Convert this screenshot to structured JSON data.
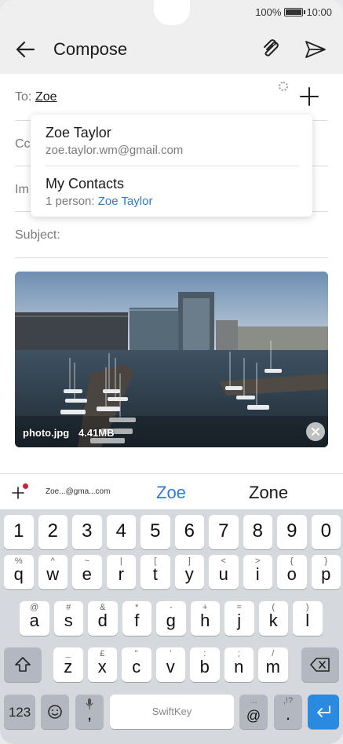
{
  "status_bar": {
    "battery_percent": "100%",
    "battery_level": 1.0,
    "time": "10:00"
  },
  "app_bar": {
    "title": "Compose",
    "back_icon": "arrow-left-icon",
    "attach_icon": "paperclip-icon",
    "send_icon": "send-icon"
  },
  "form": {
    "to_label": "To:",
    "to_value": "Zoe",
    "cc_label": "Cc",
    "im_label": "Im",
    "subject_label": "Subject:"
  },
  "suggestions": [
    {
      "name": "Zoe Taylor",
      "email": "zoe.taylor.wm@gmail.com"
    },
    {
      "name": "My Contacts",
      "count_text": "1 person:",
      "link": "Zoe Taylor"
    }
  ],
  "attachment": {
    "filename": "photo.jpg",
    "size": "4.41MB"
  },
  "keyboard": {
    "strip": {
      "email_suggestion": "Zoe...@gma...com",
      "word1": "Zoe",
      "word2": "Zone"
    },
    "number_row": [
      "1",
      "2",
      "3",
      "4",
      "5",
      "6",
      "7",
      "8",
      "9",
      "0"
    ],
    "row1": [
      {
        "k": "q",
        "s": "%"
      },
      {
        "k": "w",
        "s": "^"
      },
      {
        "k": "e",
        "s": "~"
      },
      {
        "k": "r",
        "s": "|"
      },
      {
        "k": "t",
        "s": "["
      },
      {
        "k": "y",
        "s": "]"
      },
      {
        "k": "u",
        "s": "<"
      },
      {
        "k": "i",
        "s": ">"
      },
      {
        "k": "o",
        "s": "{"
      },
      {
        "k": "p",
        "s": "}"
      }
    ],
    "row2": [
      {
        "k": "a",
        "s": "@"
      },
      {
        "k": "s",
        "s": "#"
      },
      {
        "k": "d",
        "s": "&"
      },
      {
        "k": "f",
        "s": "*"
      },
      {
        "k": "g",
        "s": "-"
      },
      {
        "k": "h",
        "s": "+"
      },
      {
        "k": "j",
        "s": "="
      },
      {
        "k": "k",
        "s": "("
      },
      {
        "k": "l",
        "s": ")"
      }
    ],
    "row3": [
      {
        "k": "z",
        "s": "_"
      },
      {
        "k": "x",
        "s": "£"
      },
      {
        "k": "c",
        "s": "\""
      },
      {
        "k": "v",
        "s": "'"
      },
      {
        "k": "b",
        "s": ":"
      },
      {
        "k": "n",
        "s": ";"
      },
      {
        "k": "m",
        "s": "/"
      }
    ],
    "sym_key": "123",
    "comma_key": ",",
    "space_label": "SwiftKey",
    "at_key": "@",
    "at_sub": "...",
    "period_key": ".",
    "period_sub": ",!?"
  }
}
